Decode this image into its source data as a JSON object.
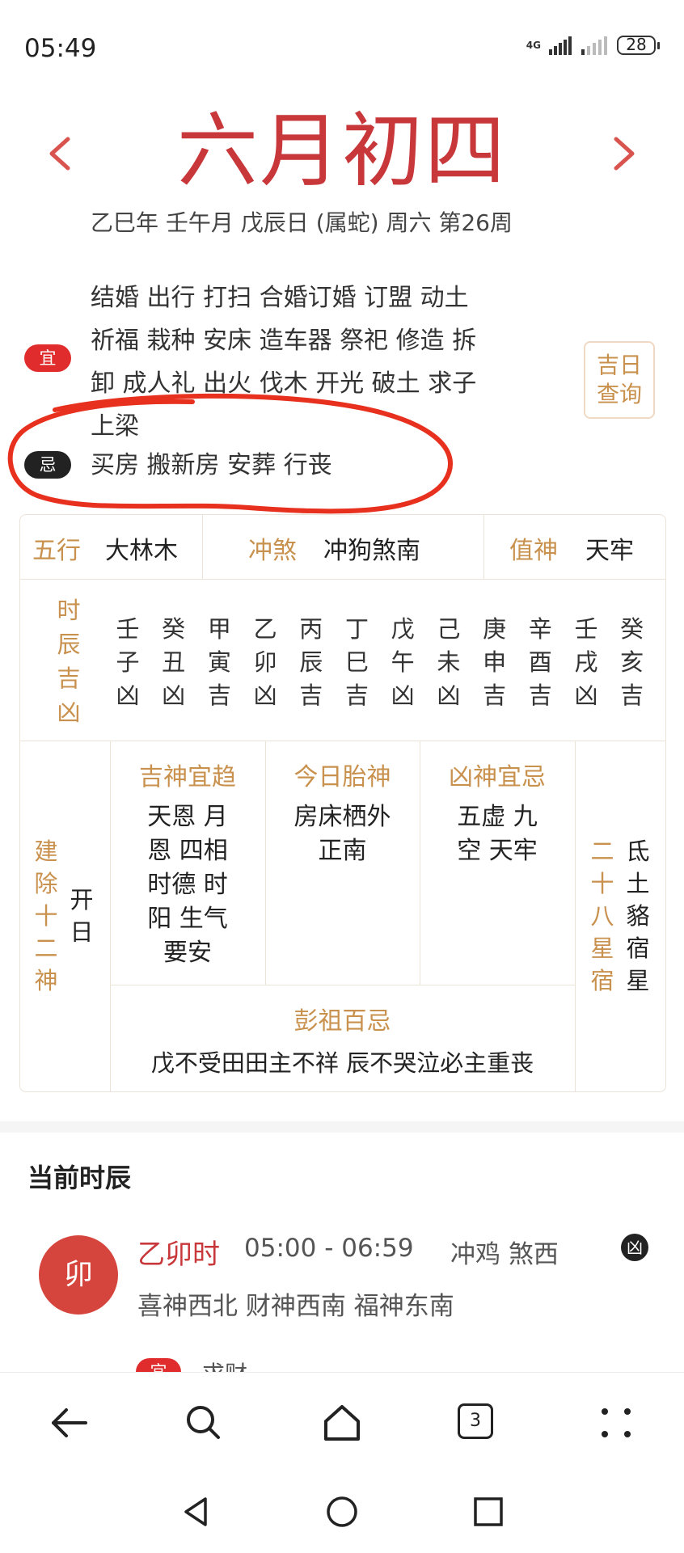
{
  "status_bar": {
    "time": "05:49",
    "network": "4G",
    "battery": "28"
  },
  "header": {
    "lunar_date": "六月初四",
    "date_info": "乙巳年 壬午月 戊辰日 (属蛇) 周六 第26周"
  },
  "yi": {
    "tag": "宜",
    "lines": [
      "结婚 出行 打扫 合婚订婚 订盟 动土",
      "祈福 栽种 安床 造车器 祭祀 修造 拆",
      "卸 成人礼 出火 伐木 开光 破土 求子",
      "上梁"
    ]
  },
  "ji": {
    "tag": "忌",
    "text": "买房 搬新房 安葬 行丧"
  },
  "jiri_button": {
    "line1": "吉日",
    "line2": "查询"
  },
  "table": {
    "wuxing": {
      "label": "五行",
      "value": "大林木"
    },
    "chongsha": {
      "label": "冲煞",
      "value": "冲狗煞南"
    },
    "zhishen": {
      "label": "值神",
      "value": "天牢"
    },
    "shichen_label": [
      "时",
      "辰",
      "吉",
      "凶"
    ],
    "shichen": [
      [
        "壬",
        "子",
        "凶"
      ],
      [
        "癸",
        "丑",
        "凶"
      ],
      [
        "甲",
        "寅",
        "吉"
      ],
      [
        "乙",
        "卯",
        "凶"
      ],
      [
        "丙",
        "辰",
        "吉"
      ],
      [
        "丁",
        "巳",
        "吉"
      ],
      [
        "戊",
        "午",
        "凶"
      ],
      [
        "己",
        "未",
        "凶"
      ],
      [
        "庚",
        "申",
        "吉"
      ],
      [
        "辛",
        "酉",
        "吉"
      ],
      [
        "壬",
        "戌",
        "凶"
      ],
      [
        "癸",
        "亥",
        "吉"
      ]
    ],
    "jianchu_label": [
      "建",
      "除",
      "十",
      "二",
      "神"
    ],
    "jianchu_value": [
      "开",
      "日"
    ],
    "jishen": {
      "label": "吉神宜趋",
      "lines": [
        "天恩 月",
        "恩 四相",
        "时德 时",
        "阳 生气",
        "要安"
      ]
    },
    "taishen": {
      "label": "今日胎神",
      "lines": [
        "房床栖外",
        "正南"
      ]
    },
    "xiongshen": {
      "label": "凶神宜忌",
      "lines": [
        "五虚 九",
        "空 天牢"
      ]
    },
    "xiu_label": [
      "二",
      "十",
      "八",
      "星",
      "宿"
    ],
    "xiu_value": [
      "氐",
      "土",
      "貉",
      "宿",
      "星"
    ],
    "pengzu": {
      "label": "彭祖百忌",
      "text": "戊不受田田主不祥 辰不哭泣必主重丧"
    }
  },
  "current": {
    "title": "当前时辰",
    "branch": "卯",
    "name": "乙卯时",
    "time": "05:00 - 06:59",
    "clash": "冲鸡 煞西",
    "badge": "凶",
    "gods": "喜神西北 财神西南 福神东南",
    "yi_tag": "宜",
    "yi_text": "求财"
  },
  "browser_bar": {
    "tab_count": "3"
  },
  "colors": {
    "accent_red": "#c8373a",
    "gold": "#c9914e",
    "annotation": "#e8301f"
  }
}
